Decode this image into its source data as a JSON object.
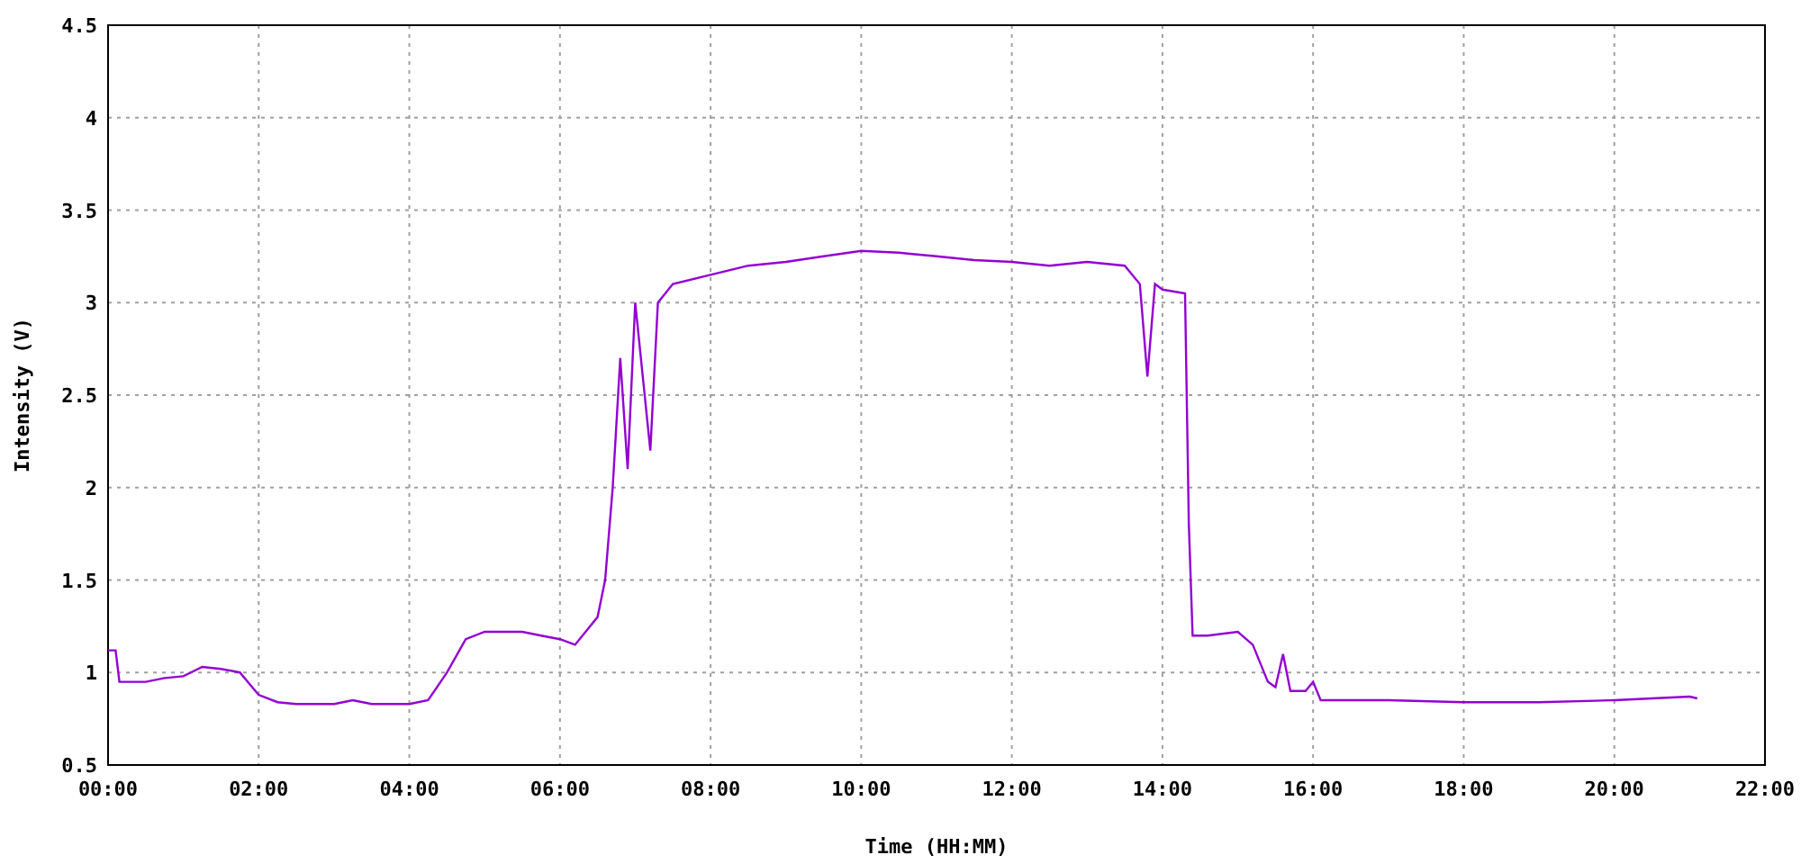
{
  "chart_data": {
    "type": "line",
    "xlabel": "Time (HH:MM)",
    "ylabel": "Intensity (V)",
    "x": [
      0,
      0.1,
      0.15,
      0.5,
      0.75,
      1,
      1.25,
      1.5,
      1.75,
      2,
      2.25,
      2.5,
      3,
      3.25,
      3.5,
      4,
      4.25,
      4.5,
      4.75,
      5,
      5.5,
      5.75,
      6,
      6.2,
      6.5,
      6.6,
      6.7,
      6.8,
      6.9,
      7,
      7.1,
      7.2,
      7.3,
      7.5,
      8,
      8.5,
      9,
      9.5,
      10,
      10.5,
      11,
      11.5,
      12,
      12.5,
      13,
      13.5,
      13.7,
      13.8,
      13.9,
      14,
      14.3,
      14.35,
      14.4,
      14.6,
      15,
      15.2,
      15.4,
      15.5,
      15.6,
      15.7,
      15.9,
      16,
      16.1,
      17,
      18,
      19,
      20,
      21,
      21.1
    ],
    "grid": true,
    "series": [
      {
        "color": "#9400d3",
        "values": [
          1.12,
          1.12,
          0.95,
          0.95,
          0.97,
          0.98,
          1.03,
          1.02,
          1.0,
          0.88,
          0.84,
          0.83,
          0.83,
          0.85,
          0.83,
          0.83,
          0.85,
          1.0,
          1.18,
          1.22,
          1.22,
          1.2,
          1.18,
          1.15,
          1.3,
          1.5,
          2.0,
          2.7,
          2.1,
          3.0,
          2.6,
          2.2,
          3.0,
          3.1,
          3.15,
          3.2,
          3.22,
          3.25,
          3.28,
          3.27,
          3.25,
          3.23,
          3.22,
          3.2,
          3.22,
          3.2,
          3.1,
          2.6,
          3.1,
          3.07,
          3.05,
          1.8,
          1.2,
          1.2,
          1.22,
          1.15,
          0.95,
          0.92,
          1.1,
          0.9,
          0.9,
          0.95,
          0.85,
          0.85,
          0.84,
          0.84,
          0.85,
          0.87,
          0.86
        ]
      }
    ],
    "xlim": [
      0,
      22
    ],
    "ylim": [
      0.5,
      4.5
    ],
    "xticks": [
      {
        "value": 0,
        "label": "00:00"
      },
      {
        "value": 2,
        "label": "02:00"
      },
      {
        "value": 4,
        "label": "04:00"
      },
      {
        "value": 6,
        "label": "06:00"
      },
      {
        "value": 8,
        "label": "08:00"
      },
      {
        "value": 10,
        "label": "10:00"
      },
      {
        "value": 12,
        "label": "12:00"
      },
      {
        "value": 14,
        "label": "14:00"
      },
      {
        "value": 16,
        "label": "16:00"
      },
      {
        "value": 18,
        "label": "18:00"
      },
      {
        "value": 20,
        "label": "20:00"
      },
      {
        "value": 22,
        "label": "22:00"
      }
    ],
    "yticks": [
      {
        "value": 0.5,
        "label": "0.5"
      },
      {
        "value": 1,
        "label": "1"
      },
      {
        "value": 1.5,
        "label": "1.5"
      },
      {
        "value": 2,
        "label": "2"
      },
      {
        "value": 2.5,
        "label": "2.5"
      },
      {
        "value": 3,
        "label": "3"
      },
      {
        "value": 3.5,
        "label": "3.5"
      },
      {
        "value": 4,
        "label": "4"
      },
      {
        "value": 4.5,
        "label": "4.5"
      }
    ]
  }
}
